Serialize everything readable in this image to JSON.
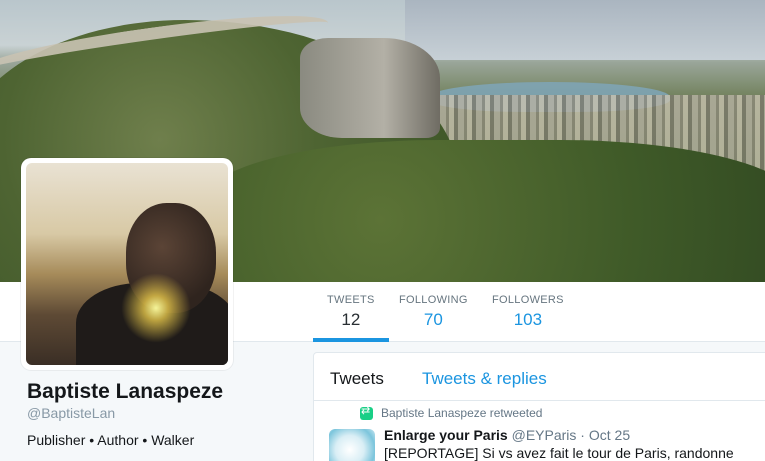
{
  "profile": {
    "name": "Baptiste Lanaspeze",
    "handle": "@BaptisteLan",
    "bio": "Publisher • Author • Walker"
  },
  "stats": [
    {
      "label": "TWEETS",
      "value": "12"
    },
    {
      "label": "FOLLOWING",
      "value": "70"
    },
    {
      "label": "FOLLOWERS",
      "value": "103"
    }
  ],
  "tabs": {
    "tweets": "Tweets",
    "replies": "Tweets & replies"
  },
  "tweet": {
    "retweet_line": "Baptiste Lanaspeze retweeted",
    "author": "Enlarge your Paris",
    "handle": "@EYParis",
    "separator": "·",
    "date": "Oct 25",
    "text": "[REPORTAGE] Si vs avez fait le tour de Paris, randonne"
  },
  "colors": {
    "accent": "#1b95e0",
    "retweet": "#19cf86"
  }
}
